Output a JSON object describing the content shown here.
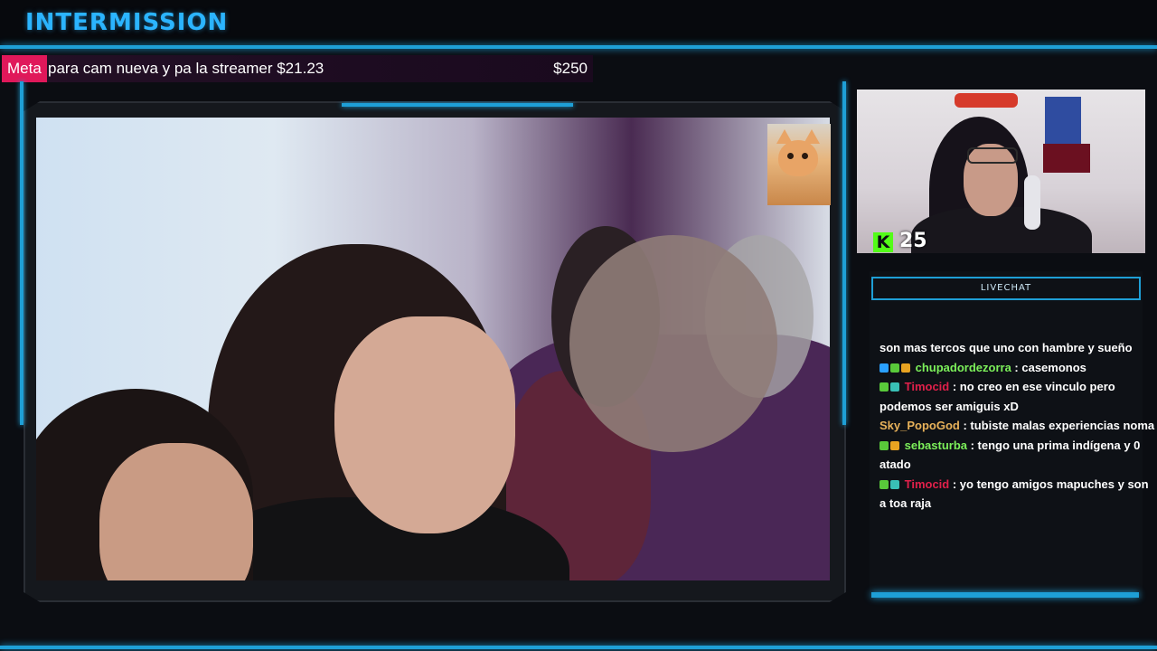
{
  "header": {
    "title": "INTERMISSION"
  },
  "goal": {
    "tag": "Meta",
    "text": "para cam nueva y pa la streamer $21.23",
    "target": "$250"
  },
  "webcam": {
    "viewer_count": "25",
    "platform_icon": "kick-icon"
  },
  "livechat": {
    "title": "LIVECHAT",
    "messages": [
      {
        "user": "",
        "text": "son mas tercos que uno con hambre y sueño",
        "badges": []
      },
      {
        "user": "chupadordezorra",
        "user_color": "#7cf05a",
        "text": " : casemonos",
        "badges": [
          "blue",
          "green",
          "orange"
        ]
      },
      {
        "user": "Timocid",
        "user_color": "#e0204a",
        "text": " : no creo en ese vinculo pero podemos ser amiguis xD",
        "badges": [
          "green",
          "teal"
        ]
      },
      {
        "user": "Sky_PopoGod",
        "user_color": "#e8b25a",
        "text": " : tubiste malas experiencias noma",
        "badges": []
      },
      {
        "user": "sebasturba",
        "user_color": "#7cf05a",
        "text": " : tengo una prima indígena y 0 atado",
        "badges": [
          "green",
          "orange"
        ]
      },
      {
        "user": "Timocid",
        "user_color": "#e0204a",
        "text": " : yo tengo amigos mapuches y son a toa raja",
        "badges": [
          "green",
          "teal"
        ]
      }
    ]
  },
  "colors": {
    "accent": "#1e9fd6",
    "title": "#2bb4ff",
    "goal_tag": "#e0185a",
    "kick": "#53fc18"
  }
}
